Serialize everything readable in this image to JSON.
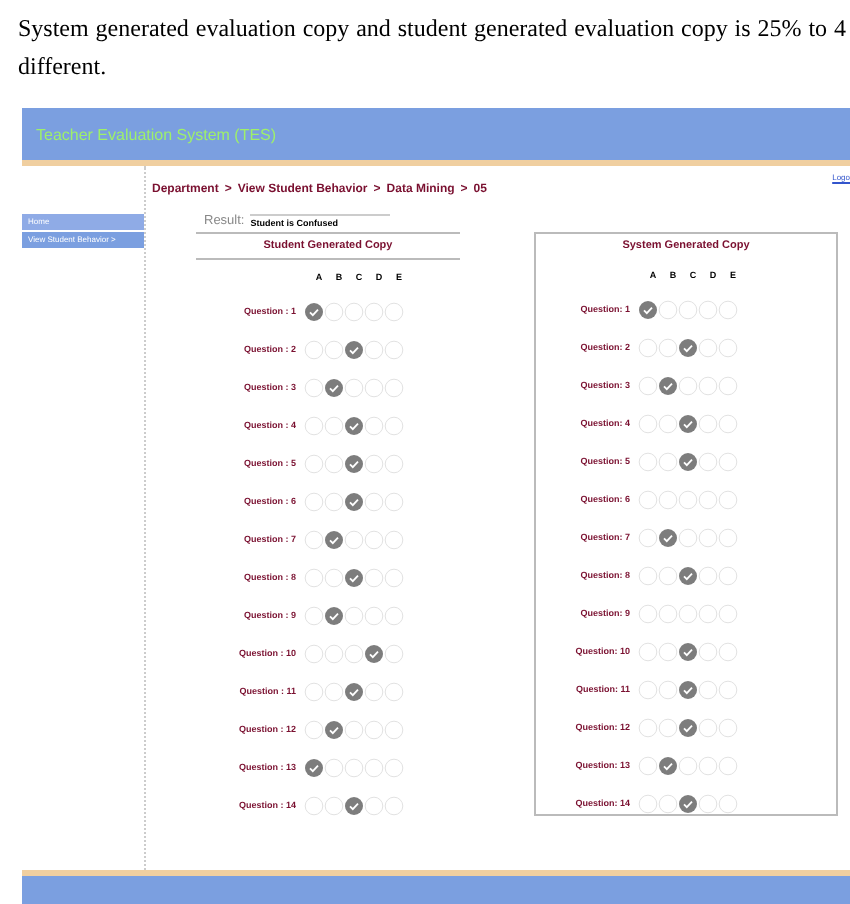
{
  "paragraph": "System generated evaluation copy and student generated evaluation copy is 25% to 4 different.",
  "app": {
    "title": "Teacher Evaluation System (TES)",
    "logout": "Logo",
    "sidebar": {
      "items": [
        {
          "label": "Home",
          "selected": false
        },
        {
          "label": "View Student Behavior  >",
          "selected": true
        }
      ]
    },
    "breadcrumb": [
      "Department",
      "View Student Behavior",
      "Data Mining",
      "05"
    ],
    "separator": ">",
    "result": {
      "label": "Result:",
      "value": "Student is Confused"
    },
    "panels": [
      {
        "title": "Student Generated Copy",
        "columns": [
          "A",
          "B",
          "C",
          "D",
          "E"
        ],
        "questions": [
          {
            "label": "Question : 1",
            "options": [
              {
                "selected": true
              },
              {
                "selected": false
              },
              {
                "selected": false
              },
              {
                "selected": false
              },
              {
                "selected": false
              }
            ]
          },
          {
            "label": "Question : 2",
            "options": [
              {
                "selected": false
              },
              {
                "selected": false
              },
              {
                "selected": true
              },
              {
                "selected": false
              },
              {
                "selected": false
              }
            ]
          },
          {
            "label": "Question : 3",
            "options": [
              {
                "selected": false
              },
              {
                "selected": true
              },
              {
                "selected": false
              },
              {
                "selected": false
              },
              {
                "selected": false
              }
            ]
          },
          {
            "label": "Question : 4",
            "options": [
              {
                "selected": false
              },
              {
                "selected": false
              },
              {
                "selected": true
              },
              {
                "selected": false
              },
              {
                "selected": false
              }
            ]
          },
          {
            "label": "Question : 5",
            "options": [
              {
                "selected": false
              },
              {
                "selected": false
              },
              {
                "selected": true
              },
              {
                "selected": false
              },
              {
                "selected": false
              }
            ]
          },
          {
            "label": "Question : 6",
            "options": [
              {
                "selected": false
              },
              {
                "selected": false
              },
              {
                "selected": true
              },
              {
                "selected": false
              },
              {
                "selected": false
              }
            ]
          },
          {
            "label": "Question : 7",
            "options": [
              {
                "selected": false
              },
              {
                "selected": true
              },
              {
                "selected": false
              },
              {
                "selected": false
              },
              {
                "selected": false
              }
            ]
          },
          {
            "label": "Question : 8",
            "options": [
              {
                "selected": false
              },
              {
                "selected": false
              },
              {
                "selected": true
              },
              {
                "selected": false
              },
              {
                "selected": false
              }
            ]
          },
          {
            "label": "Question : 9",
            "options": [
              {
                "selected": false
              },
              {
                "selected": true
              },
              {
                "selected": false
              },
              {
                "selected": false
              },
              {
                "selected": false
              }
            ]
          },
          {
            "label": "Question : 10",
            "options": [
              {
                "selected": false
              },
              {
                "selected": false
              },
              {
                "selected": false
              },
              {
                "selected": true
              },
              {
                "selected": false
              }
            ]
          },
          {
            "label": "Question : 11",
            "options": [
              {
                "selected": false
              },
              {
                "selected": false
              },
              {
                "selected": true
              },
              {
                "selected": false
              },
              {
                "selected": false
              }
            ]
          },
          {
            "label": "Question : 12",
            "options": [
              {
                "selected": false
              },
              {
                "selected": true
              },
              {
                "selected": false
              },
              {
                "selected": false
              },
              {
                "selected": false
              }
            ]
          },
          {
            "label": "Question : 13",
            "options": [
              {
                "selected": true
              },
              {
                "selected": false
              },
              {
                "selected": false
              },
              {
                "selected": false
              },
              {
                "selected": false
              }
            ]
          },
          {
            "label": "Question : 14",
            "options": [
              {
                "selected": false
              },
              {
                "selected": false
              },
              {
                "selected": true
              },
              {
                "selected": false
              },
              {
                "selected": false
              }
            ]
          }
        ]
      },
      {
        "title": "System Generated Copy",
        "columns": [
          "A",
          "B",
          "C",
          "D",
          "E"
        ],
        "questions": [
          {
            "label": "Question: 1",
            "options": [
              {
                "selected": true
              },
              {
                "selected": false
              },
              {
                "selected": false
              },
              {
                "selected": false
              },
              {
                "selected": false
              }
            ]
          },
          {
            "label": "Question: 2",
            "options": [
              {
                "selected": false
              },
              {
                "selected": false
              },
              {
                "selected": true
              },
              {
                "selected": false
              },
              {
                "selected": false
              }
            ]
          },
          {
            "label": "Question: 3",
            "options": [
              {
                "selected": false
              },
              {
                "selected": true
              },
              {
                "selected": false
              },
              {
                "selected": false
              },
              {
                "selected": false
              }
            ]
          },
          {
            "label": "Question: 4",
            "options": [
              {
                "selected": false
              },
              {
                "selected": false
              },
              {
                "selected": true
              },
              {
                "selected": false
              },
              {
                "selected": false
              }
            ]
          },
          {
            "label": "Question: 5",
            "options": [
              {
                "selected": false
              },
              {
                "selected": false
              },
              {
                "selected": true
              },
              {
                "selected": false
              },
              {
                "selected": false
              }
            ]
          },
          {
            "label": "Question: 6",
            "options": [
              {
                "selected": false
              },
              {
                "selected": false
              },
              {
                "selected": false
              },
              {
                "selected": false
              },
              {
                "selected": false
              }
            ]
          },
          {
            "label": "Question: 7",
            "options": [
              {
                "selected": false
              },
              {
                "selected": true
              },
              {
                "selected": false
              },
              {
                "selected": false
              },
              {
                "selected": false
              }
            ]
          },
          {
            "label": "Question: 8",
            "options": [
              {
                "selected": false
              },
              {
                "selected": false
              },
              {
                "selected": true
              },
              {
                "selected": false
              },
              {
                "selected": false
              }
            ]
          },
          {
            "label": "Question: 9",
            "options": [
              {
                "selected": false
              },
              {
                "selected": false
              },
              {
                "selected": false
              },
              {
                "selected": false
              },
              {
                "selected": false
              }
            ]
          },
          {
            "label": "Question: 10",
            "options": [
              {
                "selected": false
              },
              {
                "selected": false
              },
              {
                "selected": true
              },
              {
                "selected": false
              },
              {
                "selected": false
              }
            ]
          },
          {
            "label": "Question: 11",
            "options": [
              {
                "selected": false
              },
              {
                "selected": false
              },
              {
                "selected": true
              },
              {
                "selected": false
              },
              {
                "selected": false
              }
            ]
          },
          {
            "label": "Question: 12",
            "options": [
              {
                "selected": false
              },
              {
                "selected": false
              },
              {
                "selected": true
              },
              {
                "selected": false
              },
              {
                "selected": false
              }
            ]
          },
          {
            "label": "Question: 13",
            "options": [
              {
                "selected": false
              },
              {
                "selected": true
              },
              {
                "selected": false
              },
              {
                "selected": false
              },
              {
                "selected": false
              }
            ]
          },
          {
            "label": "Question: 14",
            "options": [
              {
                "selected": false
              },
              {
                "selected": false
              },
              {
                "selected": true
              },
              {
                "selected": false
              },
              {
                "selected": false
              }
            ]
          }
        ]
      }
    ]
  }
}
